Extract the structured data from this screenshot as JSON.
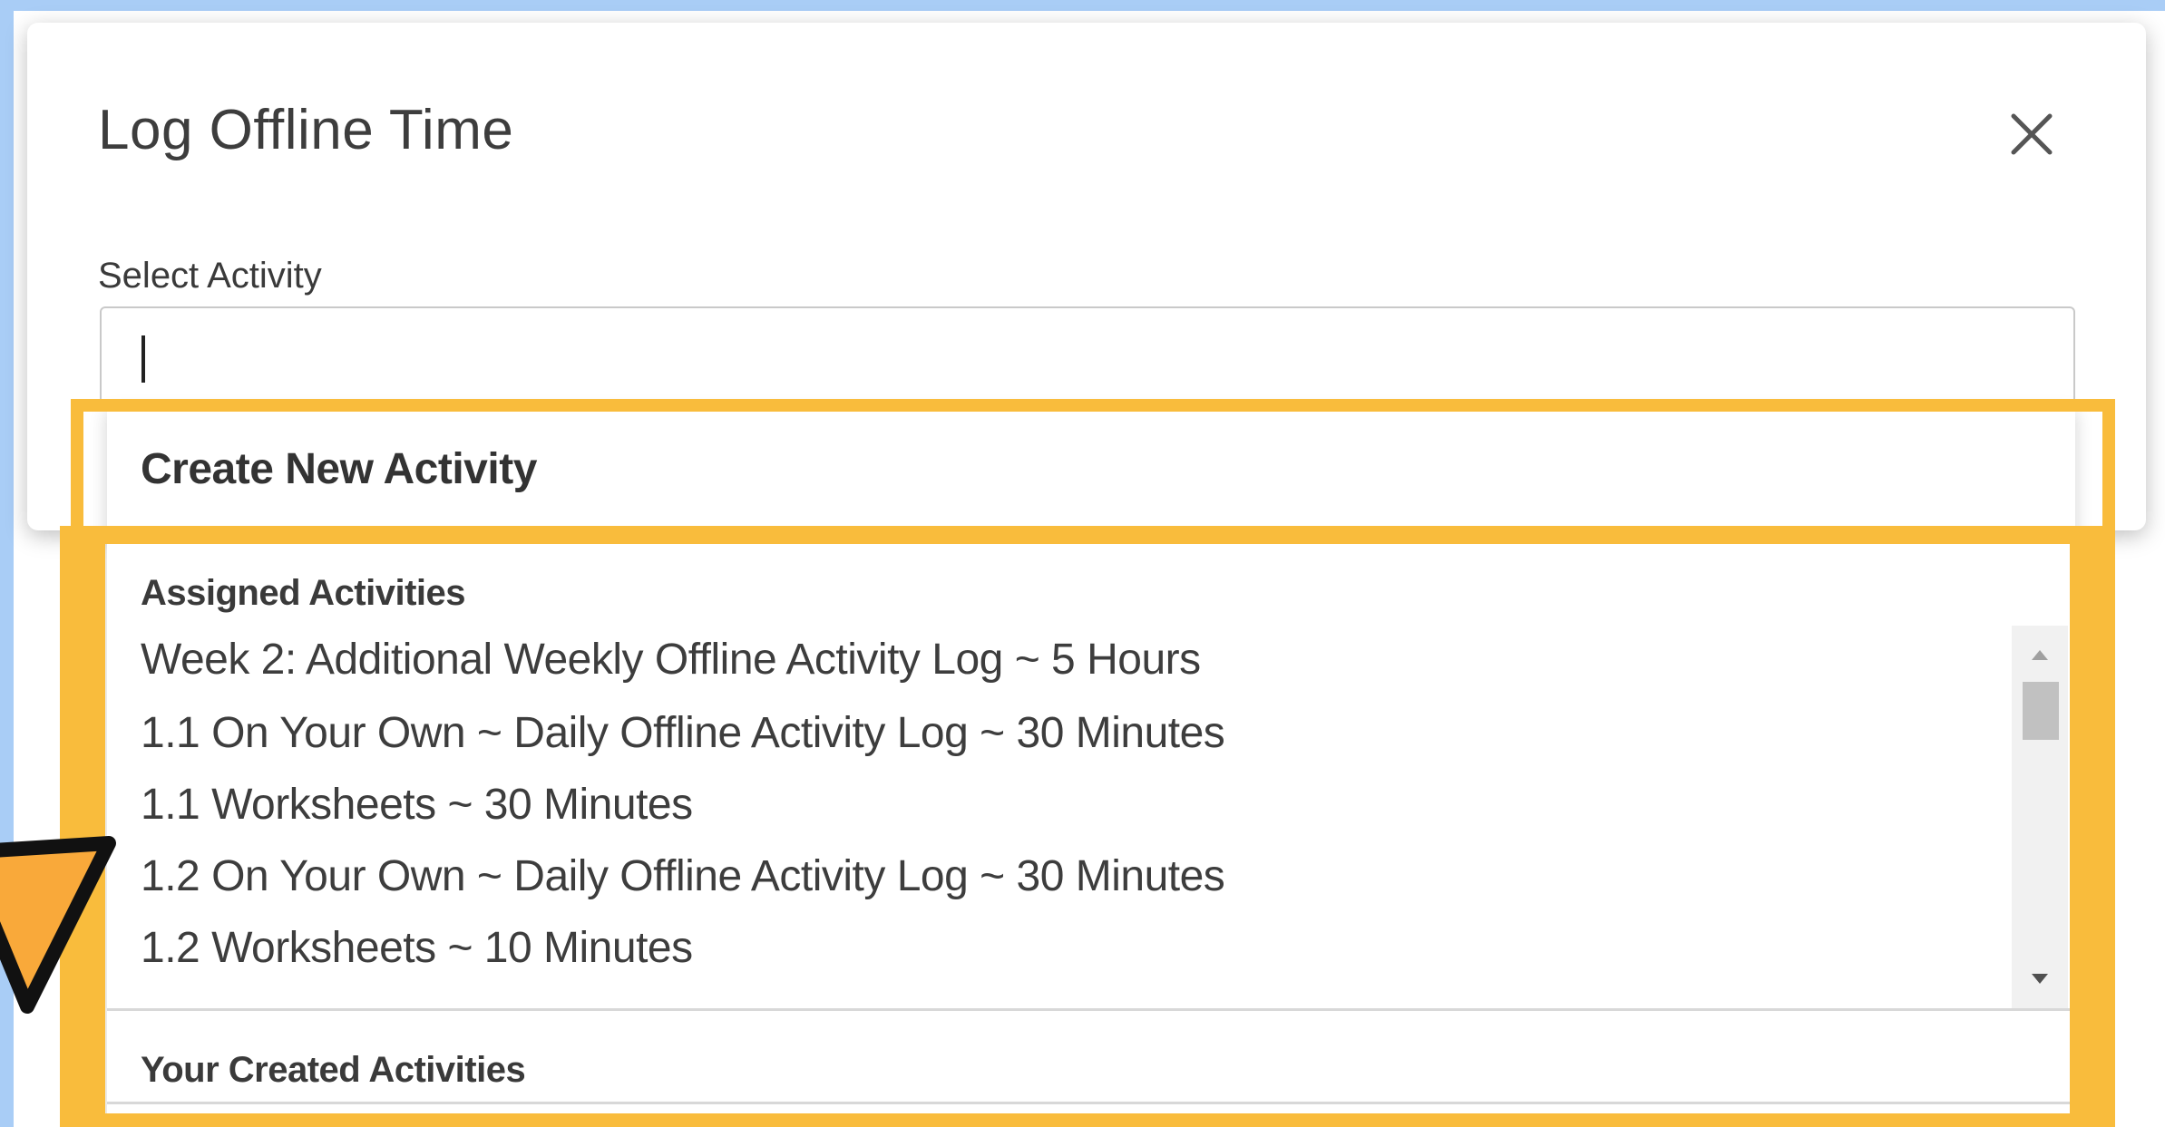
{
  "modal": {
    "title": "Log Offline Time",
    "close_icon": "close-icon"
  },
  "field": {
    "label": "Select Activity",
    "value": "",
    "placeholder": ""
  },
  "dropdown": {
    "create_new_label": "Create New Activity",
    "assigned_header": "Assigned Activities",
    "assigned_items": [
      "Week 2: Additional Weekly Offline Activity Log ~ 5 Hours",
      "1.1 On Your Own ~ Daily Offline Activity Log ~ 30 Minutes",
      "1.1 Worksheets ~ 30 Minutes",
      "1.2 On Your Own ~ Daily Offline Activity Log ~ 30 Minutes",
      "1.2 Worksheets ~ 10 Minutes"
    ],
    "created_header": "Your Created Activities"
  },
  "colors": {
    "highlight": "#f9bc3c",
    "pointer": "#f9a93a",
    "page_bg": "#a9cdf6"
  },
  "icons": {
    "close": "close-icon",
    "scroll_up": "triangle-up-icon",
    "scroll_down": "triangle-down-icon",
    "pointer": "pointer-arrow-icon"
  }
}
